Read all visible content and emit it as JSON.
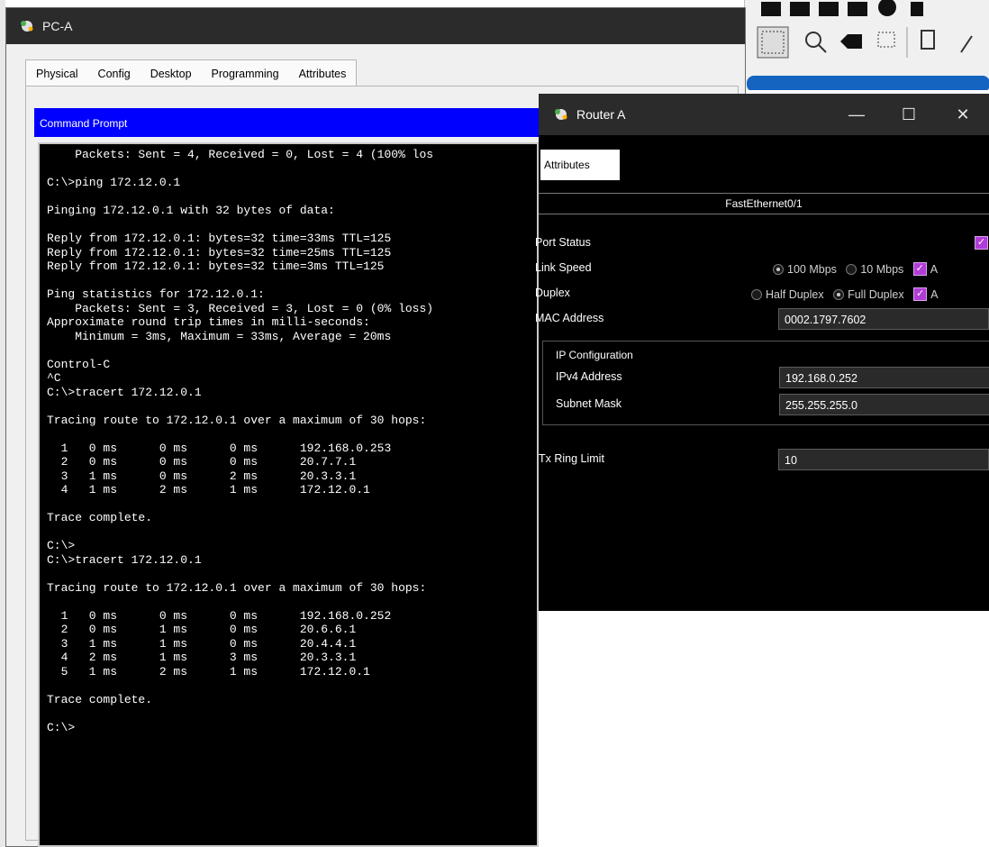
{
  "pc_window": {
    "title": "PC-A",
    "tabs": [
      "Physical",
      "Config",
      "Desktop",
      "Programming",
      "Attributes"
    ],
    "active_tab": "Desktop"
  },
  "command_prompt": {
    "title": "Command Prompt",
    "lines": [
      "    Packets: Sent = 4, Received = 0, Lost = 4 (100% los",
      "",
      "C:\\>ping 172.12.0.1",
      "",
      "Pinging 172.12.0.1 with 32 bytes of data:",
      "",
      "Reply from 172.12.0.1: bytes=32 time=33ms TTL=125",
      "Reply from 172.12.0.1: bytes=32 time=25ms TTL=125",
      "Reply from 172.12.0.1: bytes=32 time=3ms TTL=125",
      "",
      "Ping statistics for 172.12.0.1:",
      "    Packets: Sent = 3, Received = 3, Lost = 0 (0% loss)",
      "Approximate round trip times in milli-seconds:",
      "    Minimum = 3ms, Maximum = 33ms, Average = 20ms",
      "",
      "Control-C",
      "^C",
      "C:\\>tracert 172.12.0.1",
      "",
      "Tracing route to 172.12.0.1 over a maximum of 30 hops:",
      "",
      "  1   0 ms      0 ms      0 ms      192.168.0.253",
      "  2   0 ms      0 ms      0 ms      20.7.7.1",
      "  3   1 ms      0 ms      2 ms      20.3.3.1",
      "  4   1 ms      2 ms      1 ms      172.12.0.1",
      "",
      "Trace complete.",
      "",
      "C:\\>",
      "C:\\>tracert 172.12.0.1",
      "",
      "Tracing route to 172.12.0.1 over a maximum of 30 hops:",
      "",
      "  1   0 ms      0 ms      0 ms      192.168.0.252",
      "  2   0 ms      1 ms      0 ms      20.6.6.1",
      "  3   1 ms      1 ms      0 ms      20.4.4.1",
      "  4   2 ms      1 ms      3 ms      20.3.3.1",
      "  5   1 ms      2 ms      1 ms      172.12.0.1",
      "",
      "Trace complete.",
      "",
      "C:\\>"
    ]
  },
  "router_window": {
    "title": "Router A",
    "controls": {
      "minimize": "—",
      "maximize": "☐",
      "close": "✕"
    },
    "tab": "Attributes",
    "interface_name": "FastEthernet0/1",
    "port_status": {
      "label": "Port Status",
      "checked": true
    },
    "link_speed": {
      "label": "Link Speed",
      "options": [
        "100 Mbps",
        "10 Mbps"
      ],
      "selected": "100 Mbps",
      "auto_label": "A"
    },
    "duplex": {
      "label": "Duplex",
      "options": [
        "Half Duplex",
        "Full Duplex"
      ],
      "selected": "Full Duplex",
      "auto_label": "A"
    },
    "mac_address": {
      "label": "MAC Address",
      "value": "0002.1797.7602"
    },
    "ip_config": {
      "header": "IP Configuration",
      "ipv4_label": "IPv4 Address",
      "ipv4_value": "192.168.0.252",
      "mask_label": "Subnet Mask",
      "mask_value": "255.255.255.0"
    },
    "tx_ring": {
      "label": "Tx Ring Limit",
      "value": "10"
    }
  },
  "colors": {
    "cmd_title_bg": "#0000ff",
    "terminal_bg": "#000000",
    "dark_titlebar": "#2b2b2b",
    "checkbox": "#b23cd9"
  }
}
